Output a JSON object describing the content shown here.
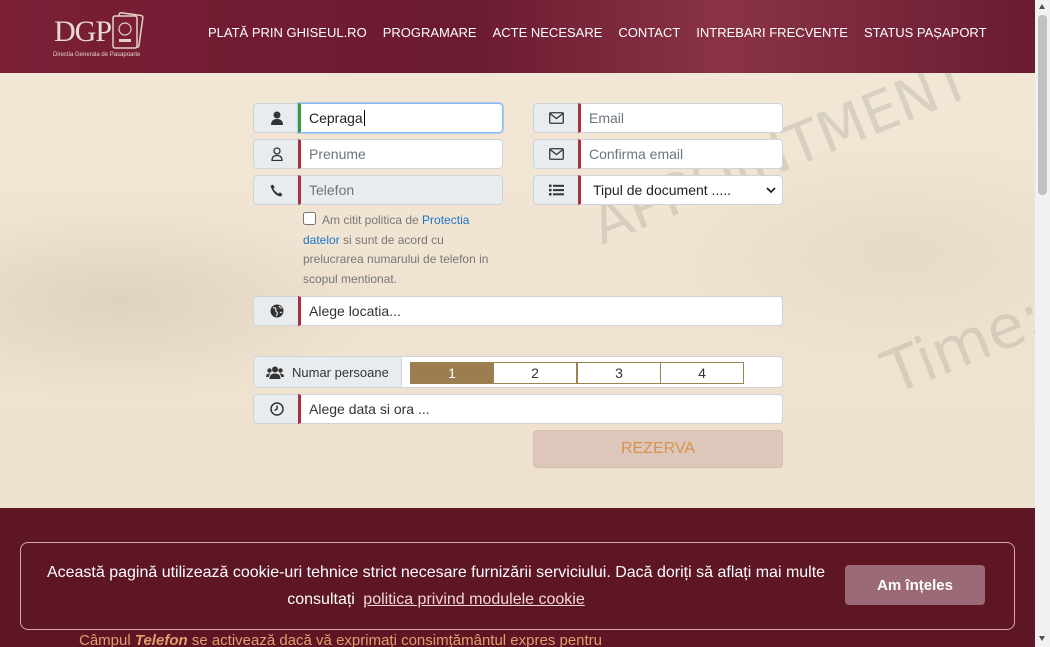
{
  "header": {
    "logo_text": "DGP",
    "logo_subtitle": "Directia Generala de Pasapoarte",
    "nav": [
      "PLATĂ PRIN GHISEUL.RO",
      "PROGRAMARE",
      "ACTE NECESARE",
      "CONTACT",
      "INTREBARI FRECVENTE",
      "STATUS PAȘAPORT"
    ]
  },
  "form": {
    "nume_value": "Cepraga",
    "prenume_placeholder": "Prenume",
    "telefon_placeholder": "Telefon",
    "email_placeholder": "Email",
    "confirm_email_placeholder": "Confirma email",
    "document_select": "Tipul de document .....",
    "consent_text_1": "Am citit politica de",
    "consent_link": "Protectia datelor",
    "consent_text_2": "si sunt de acord cu prelucrarea numarului de telefon in scopul mentionat.",
    "location_placeholder": "Alege locatia...",
    "persons_label": "Numar persoane",
    "persons_options": [
      "1",
      "2",
      "3",
      "4"
    ],
    "persons_selected": "1",
    "date_placeholder": "Alege data si ora ...",
    "submit_label": "REZERVA"
  },
  "cookie": {
    "text": "Această pagină utilizează cookie-uri tehnice strict necesare furnizării serviciului. Dacă doriți să aflați mai multe consultați",
    "link": "politica privind modulele cookie",
    "button": "Am înțeles"
  },
  "footer": {
    "note_prefix": "Câmpul",
    "note_bold": "Telefon",
    "note_suffix": "se activează dacă vă exprimați consimțământul expres pentru"
  },
  "colors": {
    "header": "#6b1a30",
    "footer": "#5e1524",
    "accent_border": "#a83240",
    "persons_selected": "#9b7d4f",
    "submit_text": "#d8924f"
  },
  "icons": [
    "user-icon",
    "user-outline-icon",
    "phone-icon",
    "envelope-icon",
    "list-icon",
    "globe-icon",
    "users-icon",
    "clock-icon",
    "chevron-down-icon"
  ]
}
